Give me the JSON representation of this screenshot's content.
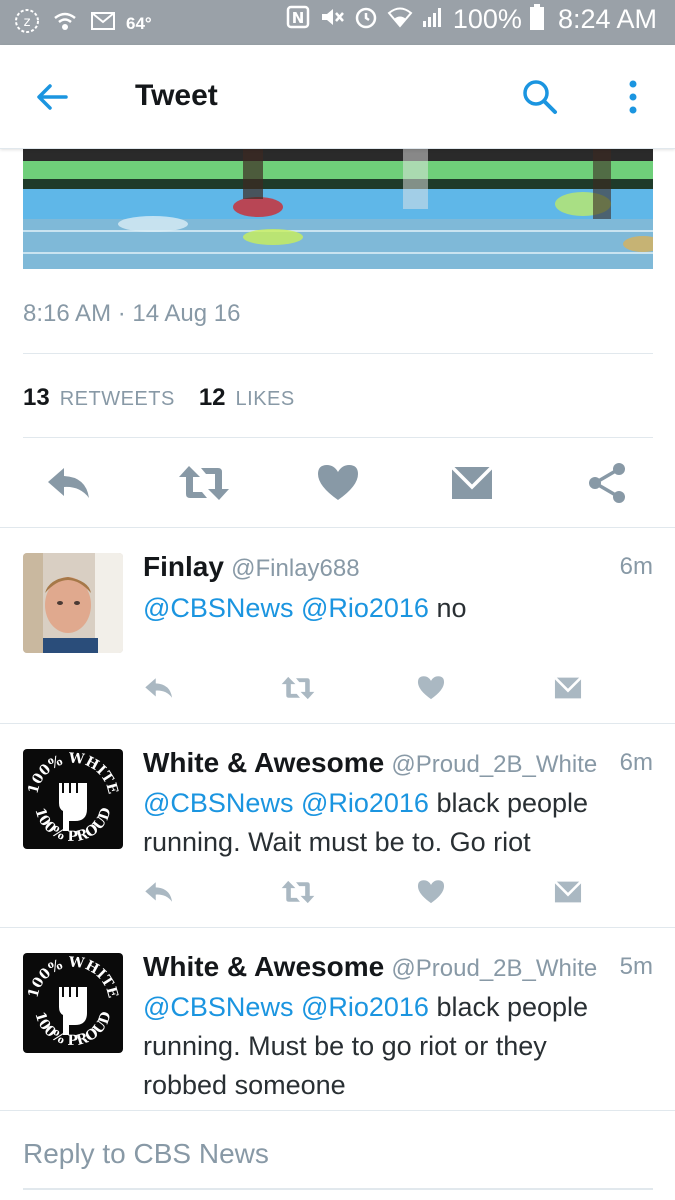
{
  "status_bar": {
    "temperature": "64°",
    "battery": "100%",
    "time": "8:24 AM",
    "icons": [
      "zedge-icon",
      "wifi-call-icon",
      "gmail-icon",
      "nfc-icon",
      "mute-icon",
      "alarm-icon",
      "wifi-icon",
      "signal-icon",
      "battery-icon"
    ]
  },
  "app_bar": {
    "title": "Tweet",
    "accent_color": "#1b95e0"
  },
  "tweet": {
    "timestamp": "8:16 AM · 14 Aug 16",
    "retweets_count": "13",
    "retweets_label": "RETWEETS",
    "likes_count": "12",
    "likes_label": "LIKES",
    "actions": [
      "reply-icon",
      "retweet-icon",
      "like-icon",
      "direct-message-icon",
      "share-icon"
    ]
  },
  "replies": [
    {
      "name": "Finlay",
      "handle": "@Finlay688",
      "time": "6m",
      "mentions": "@CBSNews @Rio2016",
      "text": " no"
    },
    {
      "name": "White & Awesome",
      "handle": "@Proud_2B_White",
      "time": "6m",
      "mentions": "@CBSNews @Rio2016",
      "text": " black people running. Wait must be to. Go riot",
      "avatar_text_top": "100% WHITE",
      "avatar_text_bottom": "100% PROUD"
    },
    {
      "name": "White & Awesome",
      "handle": "@Proud_2B_White",
      "time": "5m",
      "mentions": "@CBSNews @Rio2016",
      "text": " black people running. Must be to go riot or they robbed someone",
      "avatar_text_top": "100% WHITE",
      "avatar_text_bottom": "100% PROUD"
    }
  ],
  "composer": {
    "placeholder": "Reply to CBS News"
  }
}
